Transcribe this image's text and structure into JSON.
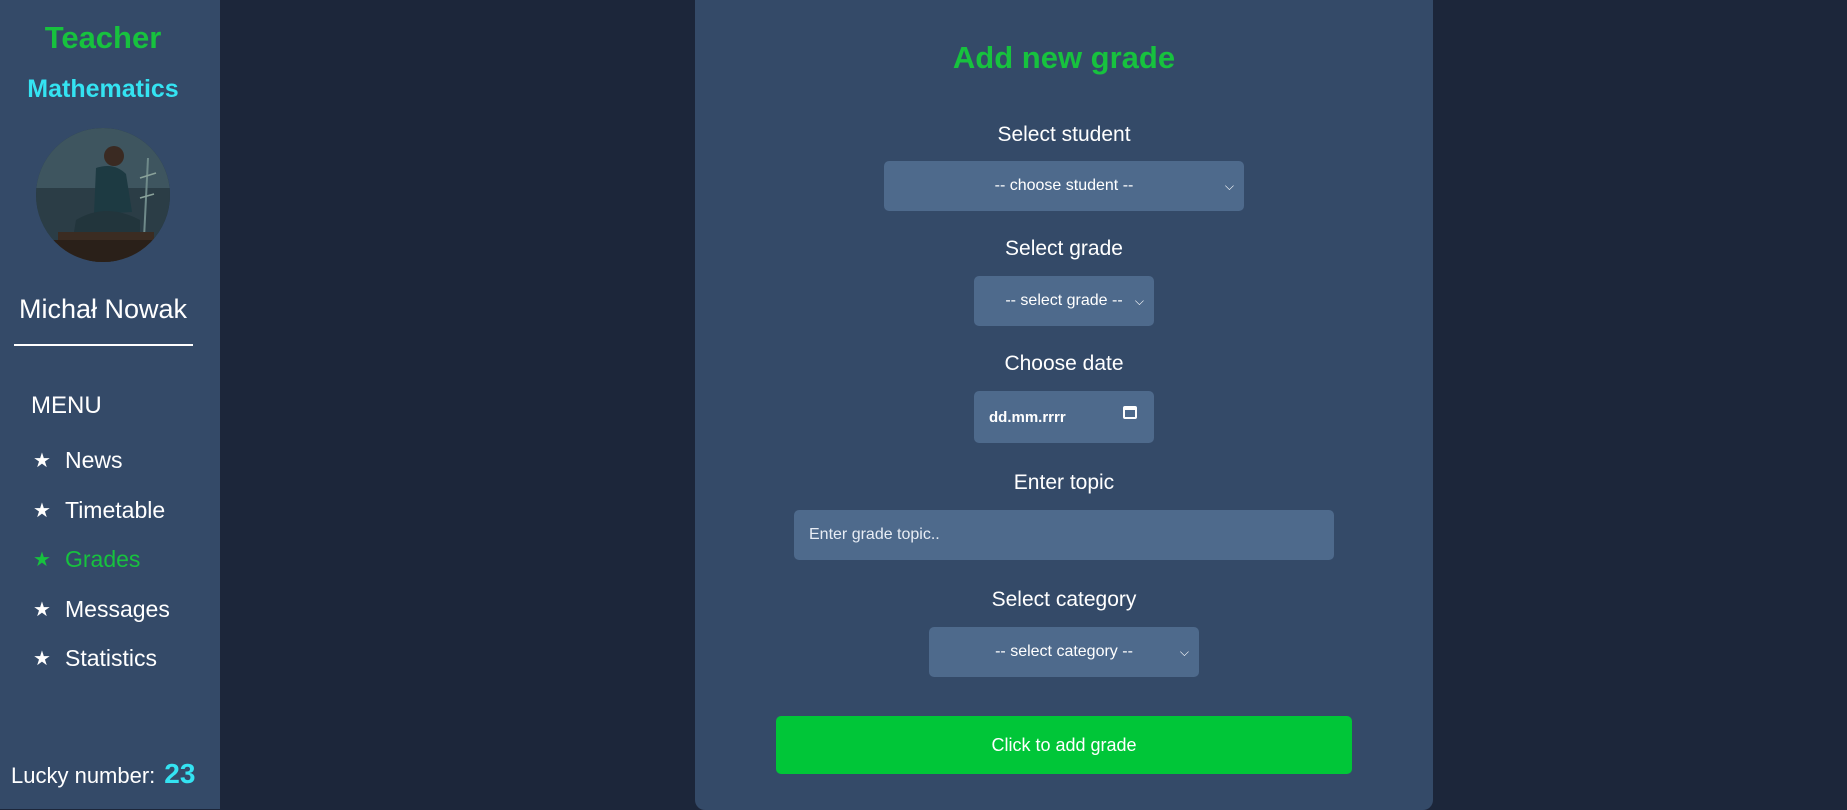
{
  "sidebar": {
    "role": "Teacher",
    "subject": "Mathematics",
    "username": "Michał Nowak",
    "menu_heading": "MENU",
    "menu_items": [
      {
        "label": "News",
        "icon": "star-icon",
        "active": false
      },
      {
        "label": "Timetable",
        "icon": "star-icon",
        "active": false
      },
      {
        "label": "Grades",
        "icon": "star-icon",
        "active": true
      },
      {
        "label": "Messages",
        "icon": "star-icon",
        "active": false
      },
      {
        "label": "Statistics",
        "icon": "star-icon",
        "active": false
      }
    ],
    "lucky_label": "Lucky number:",
    "lucky_number": "23"
  },
  "form": {
    "title": "Add new grade",
    "student_label": "Select student",
    "student_value": "-- choose student --",
    "grade_label": "Select grade",
    "grade_value": "-- select grade --",
    "date_label": "Choose date",
    "date_placeholder": "dd.mm.rrrr",
    "topic_label": "Enter topic",
    "topic_placeholder": "Enter grade topic..",
    "category_label": "Select category",
    "category_value": "-- select category --",
    "submit_label": "Click to add grade"
  },
  "colors": {
    "page_background": "#1c263a",
    "panel_background": "#344a68",
    "control_background": "#4e6a8c",
    "accent_green": "#17c23e",
    "accent_cyan": "#34e3f2",
    "button_green": "#00c638"
  }
}
